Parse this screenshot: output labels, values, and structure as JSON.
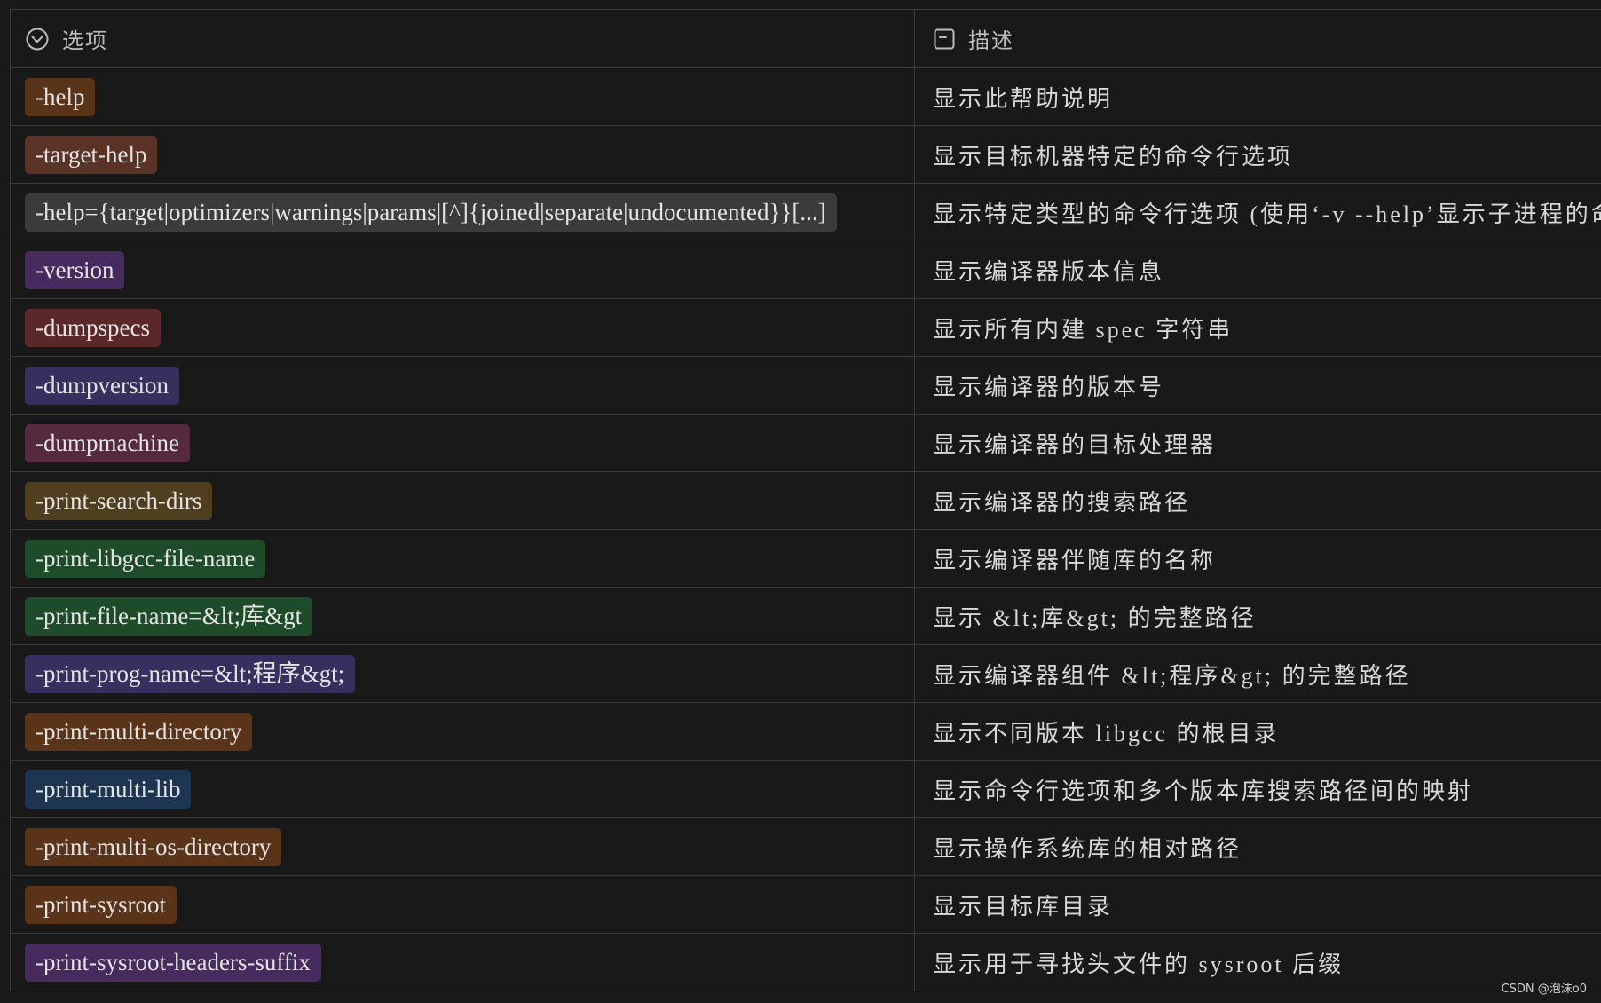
{
  "header": {
    "col1_label": "选项",
    "col1_icon": "chevron-down-circle-icon",
    "col2_label": "描述",
    "col2_icon": "text-box-icon"
  },
  "rows": [
    {
      "option": "-help",
      "desc": "显示此帮助说明",
      "color": "#5a3418"
    },
    {
      "option": "-target-help",
      "desc": "显示目标机器特定的命令行选项",
      "color": "#5a3226"
    },
    {
      "option": "-help={target|optimizers|warnings|params|[^]{joined|separate|undocumented}}[...]",
      "desc": "显示特定类型的命令行选项 (使用‘-v --help’显示子进程的命令",
      "color": "#3b3b3b"
    },
    {
      "option": "-version",
      "desc": "显示编译器版本信息",
      "color": "#472a5e"
    },
    {
      "option": "-dumpspecs",
      "desc": "显示所有内建 spec 字符串",
      "color": "#5a2828"
    },
    {
      "option": "-dumpversion",
      "desc": "显示编译器的版本号",
      "color": "#37305e"
    },
    {
      "option": "-dumpmachine",
      "desc": "显示编译器的目标处理器",
      "color": "#552a3f"
    },
    {
      "option": "-print-search-dirs",
      "desc": "显示编译器的搜索路径",
      "color": "#503f1e"
    },
    {
      "option": "-print-libgcc-file-name",
      "desc": "显示编译器伴随库的名称",
      "color": "#1e4b29"
    },
    {
      "option": "-print-file-name=&lt;库&gt",
      "desc": "显示 &lt;库&gt; 的完整路径",
      "color": "#1e4b29"
    },
    {
      "option": "-print-prog-name=&lt;程序&gt;",
      "desc": "显示编译器组件 &lt;程序&gt; 的完整路径",
      "color": "#37305e"
    },
    {
      "option": "-print-multi-directory",
      "desc": "显示不同版本 libgcc 的根目录",
      "color": "#5a3418"
    },
    {
      "option": "-print-multi-lib",
      "desc": "显示命令行选项和多个版本库搜索路径间的映射",
      "color": "#1e3552"
    },
    {
      "option": "-print-multi-os-directory",
      "desc": "显示操作系统库的相对路径",
      "color": "#5a3418"
    },
    {
      "option": "-print-sysroot",
      "desc": "显示目标库目录",
      "color": "#5a3418"
    },
    {
      "option": "-print-sysroot-headers-suffix",
      "desc": "显示用于寻找头文件的 sysroot 后缀",
      "color": "#472a5e"
    }
  ],
  "watermark": "CSDN @泡沫o0"
}
